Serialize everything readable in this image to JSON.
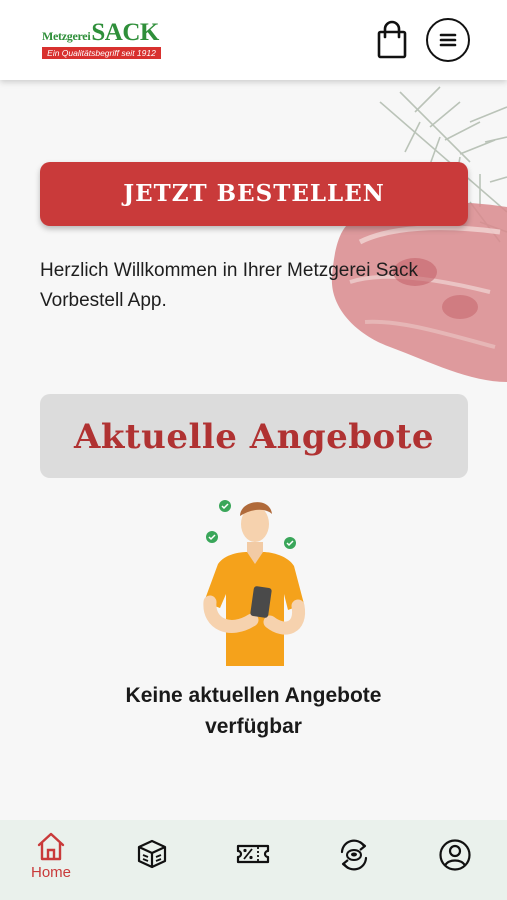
{
  "header": {
    "logo_word": "Metzgerei",
    "logo_name": "SACK",
    "logo_tagline": "Ein Qualitätsbegriff seit 1912",
    "cart_icon": "shopping-bag-icon",
    "menu_icon": "menu-icon"
  },
  "main": {
    "order_button": "JETZT BESTELLEN",
    "welcome_text": "Herzlich Willkommen in Ihrer Metzgerei Sack Vorbestell App.",
    "offers_heading": "Aktuelle Angebote",
    "empty_state": "Keine aktuellen Angebote verfügbar"
  },
  "bottom_nav": {
    "items": [
      {
        "label": "Home",
        "icon": "home-icon",
        "active": true
      },
      {
        "label": "",
        "icon": "box-icon",
        "active": false
      },
      {
        "label": "",
        "icon": "coupon-icon",
        "active": false
      },
      {
        "label": "",
        "icon": "reorder-icon",
        "active": false
      },
      {
        "label": "",
        "icon": "profile-icon",
        "active": false
      }
    ]
  },
  "colors": {
    "brand_red": "#c93a3a",
    "brand_green": "#2f8f3a",
    "nav_bg": "#eaf1ec",
    "offers_bg": "#dcdcdc",
    "person_shirt": "#f5a21b"
  }
}
